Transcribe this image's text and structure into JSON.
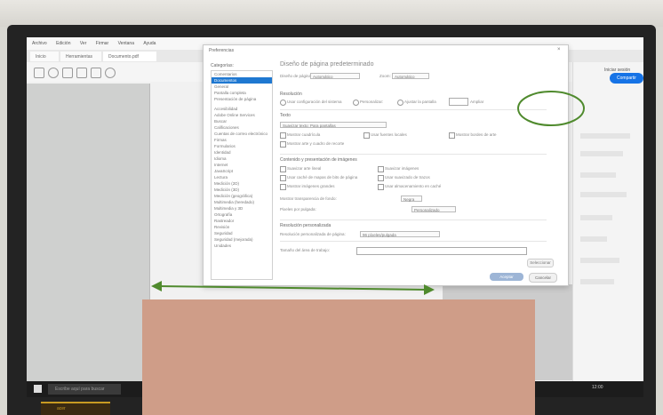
{
  "app": {
    "menu": [
      "Archivo",
      "Edición",
      "Ver",
      "Firmar",
      "Ventana",
      "Ayuda"
    ],
    "tabs": [
      "Inicio",
      "Herramientas",
      "Documento.pdf"
    ],
    "signin": "Iniciar sesión",
    "share_label": "Compartir",
    "search_placeholder": "Escribe aquí para buscar",
    "clock": "12:00"
  },
  "dialog": {
    "title": "Preferencias",
    "close": "×",
    "categories_label": "Categorías:",
    "categories": [
      {
        "label": "Comentarios",
        "selected": false
      },
      {
        "label": "Documentos",
        "selected": true
      },
      {
        "label": "General",
        "selected": false
      },
      {
        "label": "Pantalla completa",
        "selected": false
      },
      {
        "label": "Presentación de página",
        "selected": false
      },
      {
        "label": "Accesibilidad",
        "selected": false
      },
      {
        "label": "Adobe Online Services",
        "selected": false
      },
      {
        "label": "Buscar",
        "selected": false
      },
      {
        "label": "Calificaciones",
        "selected": false
      },
      {
        "label": "Cuentas de correo electrónico",
        "selected": false
      },
      {
        "label": "Firmas",
        "selected": false
      },
      {
        "label": "Formularios",
        "selected": false
      },
      {
        "label": "Identidad",
        "selected": false
      },
      {
        "label": "Idioma",
        "selected": false
      },
      {
        "label": "Internet",
        "selected": false
      },
      {
        "label": "JavaScript",
        "selected": false
      },
      {
        "label": "Lectura",
        "selected": false
      },
      {
        "label": "Medición (2D)",
        "selected": false
      },
      {
        "label": "Medición (3D)",
        "selected": false
      },
      {
        "label": "Medición (geográfica)",
        "selected": false
      },
      {
        "label": "Multimedia (heredado)",
        "selected": false
      },
      {
        "label": "Multimedia y 3D",
        "selected": false
      },
      {
        "label": "Ortografía",
        "selected": false
      },
      {
        "label": "Rastreador",
        "selected": false
      },
      {
        "label": "Revisión",
        "selected": false
      },
      {
        "label": "Seguridad",
        "selected": false
      },
      {
        "label": "Seguridad (mejorada)",
        "selected": false
      },
      {
        "label": "Unidades",
        "selected": false
      }
    ],
    "heading": "Diseño de página predeterminado",
    "page_layout_label": "Diseño de página:",
    "page_layout_value": "Automático",
    "zoom_label": "Zoom:",
    "zoom_value": "Automático",
    "resolution_section": "Resolución",
    "resolution_options": [
      "Usar configuración del sistema",
      "Personalizar:",
      "Ajustar la pantalla",
      "Ampliar"
    ],
    "text_section": "Texto",
    "text_dropdown": "Suavizar texto: Para pantallas",
    "text_checks": [
      "Mostrar cuadrícula",
      "Usar fuentes locales",
      "Mostrar bordes de arte",
      "Mostrar arte y cuadro de recorte"
    ],
    "images_section": "Contenido y presentación de imágenes",
    "image_checks": [
      "Suavizar arte lineal",
      "Suavizar imágenes",
      "Usar caché de mapas de bits de página",
      "Usar suavizado de trazos",
      "Mostrar imágenes grandes",
      "Usar almacenamiento en caché"
    ],
    "transparency_label": "Mostrar transparencia de fondo:",
    "transparency_value": "Negra",
    "pixel_label": "Pixeles por pulgada:",
    "pixel_value": "Personalizado",
    "custom_section": "Resolución personalizada",
    "custom_label": "Resolución personalizada de página:",
    "custom_value": "96 píxeles/pulgada",
    "size_label": "Tamaño del área de trabajo:",
    "select_button": "Seleccionar",
    "ok_label": "Aceptar",
    "cancel_label": "Cancelar"
  },
  "logo_text": "acer"
}
